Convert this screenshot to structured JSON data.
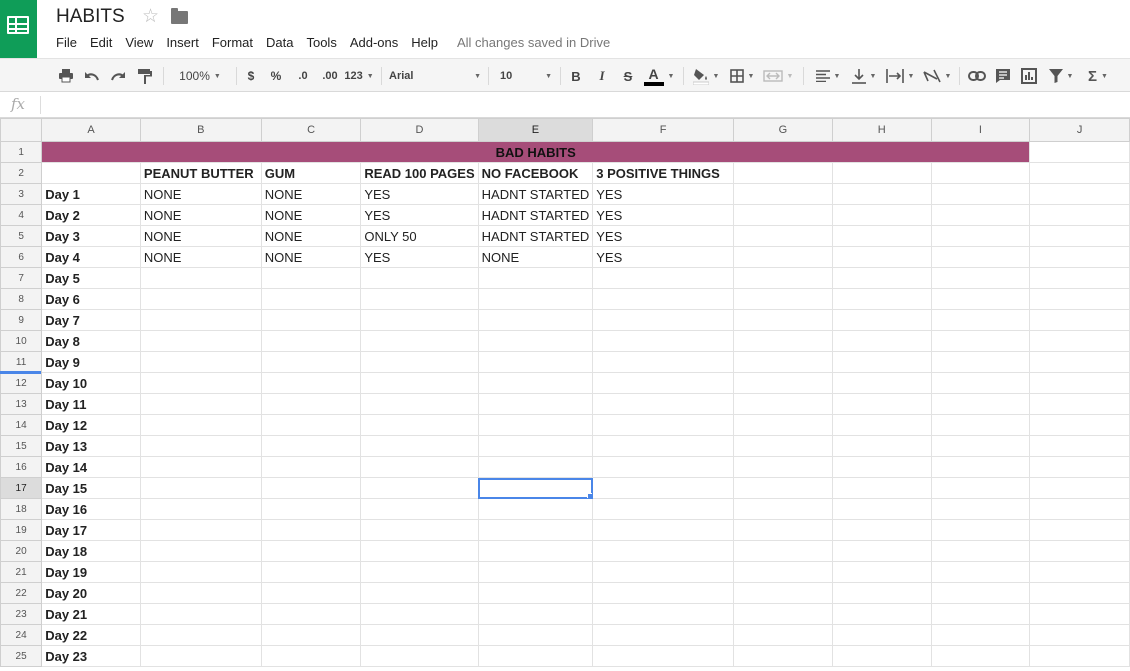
{
  "app": {
    "title": "HABITS",
    "save_status": "All changes saved in Drive"
  },
  "menu": [
    "File",
    "Edit",
    "View",
    "Insert",
    "Format",
    "Data",
    "Tools",
    "Add-ons",
    "Help"
  ],
  "toolbar": {
    "zoom": "100%",
    "currency": "$",
    "percent": "%",
    "decrease_decimal": ".0",
    "increase_decimal": ".00",
    "more_formats": "123",
    "font": "Arial",
    "font_size": "10",
    "bold": "B",
    "italic": "I",
    "strikethrough": "S",
    "text_color_letter": "A",
    "text_color": "#000000",
    "fill_color": "#ffffff",
    "function": "Σ",
    "icons": [
      "print-icon",
      "undo-icon",
      "redo-icon",
      "paint-format-icon",
      "text-color-icon",
      "fill-color-icon",
      "borders-icon",
      "merge-cells-icon",
      "horizontal-align-icon",
      "vertical-align-icon",
      "text-wrap-icon",
      "text-rotation-icon",
      "insert-link-icon",
      "insert-comment-icon",
      "insert-chart-icon",
      "filter-icon",
      "functions-icon"
    ]
  },
  "formula_bar": {
    "label": "fx",
    "value": ""
  },
  "grid": {
    "columns": [
      "A",
      "B",
      "C",
      "D",
      "E",
      "F",
      "G",
      "H",
      "I",
      "J"
    ],
    "selected_column": "E",
    "selected_row": 17,
    "title": "BAD HABITS",
    "title_color": "#a64d79",
    "headers": [
      "",
      "PEANUT BUTTER",
      "GUM",
      "READ 100 PAGES",
      "NO FACEBOOK",
      "3 POSITIVE THINGS"
    ],
    "rows": [
      [
        "Day 1",
        "NONE",
        "NONE",
        "YES",
        "HADNT STARTED",
        "YES"
      ],
      [
        "Day 2",
        "NONE",
        "NONE",
        "YES",
        "HADNT STARTED",
        "YES"
      ],
      [
        "Day 3",
        "NONE",
        "NONE",
        "ONLY 50",
        "HADNT STARTED",
        "YES"
      ],
      [
        "Day 4",
        "NONE",
        "NONE",
        "YES",
        "NONE",
        "YES"
      ],
      [
        "Day 5",
        "",
        "",
        "",
        "",
        ""
      ],
      [
        "Day 6",
        "",
        "",
        "",
        "",
        ""
      ],
      [
        "Day 7",
        "",
        "",
        "",
        "",
        ""
      ],
      [
        "Day 8",
        "",
        "",
        "",
        "",
        ""
      ],
      [
        "Day 9",
        "",
        "",
        "",
        "",
        ""
      ],
      [
        "Day 10",
        "",
        "",
        "",
        "",
        ""
      ],
      [
        "Day 11",
        "",
        "",
        "",
        "",
        ""
      ],
      [
        "Day 12",
        "",
        "",
        "",
        "",
        ""
      ],
      [
        "Day 13",
        "",
        "",
        "",
        "",
        ""
      ],
      [
        "Day 14",
        "",
        "",
        "",
        "",
        ""
      ],
      [
        "Day 15",
        "",
        "",
        "",
        "",
        ""
      ],
      [
        "Day 16",
        "",
        "",
        "",
        "",
        ""
      ],
      [
        "Day 17",
        "",
        "",
        "",
        "",
        ""
      ],
      [
        "Day 18",
        "",
        "",
        "",
        "",
        ""
      ],
      [
        "Day 19",
        "",
        "",
        "",
        "",
        ""
      ],
      [
        "Day 20",
        "",
        "",
        "",
        "",
        ""
      ],
      [
        "Day 21",
        "",
        "",
        "",
        "",
        ""
      ],
      [
        "Day 22",
        "",
        "",
        "",
        "",
        ""
      ],
      [
        "Day 23",
        "",
        "",
        "",
        "",
        ""
      ]
    ]
  }
}
